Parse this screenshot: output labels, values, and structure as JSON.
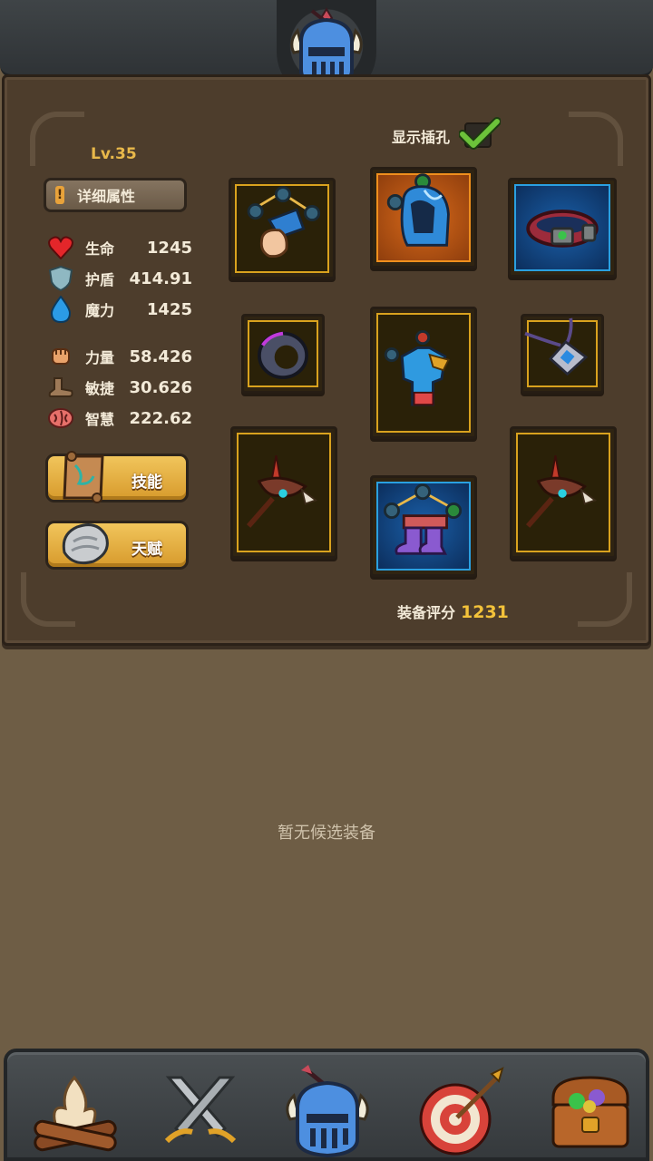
{
  "header": {
    "emblem_icon": "knight-helmet-icon"
  },
  "character": {
    "level": "Lv.35",
    "detail_button": "详细属性",
    "stats": [
      {
        "icon": "heart-icon",
        "label": "生命",
        "value": "1245"
      },
      {
        "icon": "shield-icon",
        "label": "护盾",
        "value": "414.91"
      },
      {
        "icon": "water-drop-icon",
        "label": "魔力",
        "value": "1425"
      }
    ],
    "attributes": [
      {
        "icon": "fist-icon",
        "label": "力量",
        "value": "58.426"
      },
      {
        "icon": "boot-icon",
        "label": "敏捷",
        "value": "30.626"
      },
      {
        "icon": "brain-icon",
        "label": "智慧",
        "value": "222.62"
      }
    ],
    "skill_button": "技能",
    "talent_button": "天赋"
  },
  "equipment": {
    "show_slots_label": "显示插孔",
    "show_slots_checked": true,
    "score_label": "装备评分",
    "score_value": "1231",
    "slots": [
      {
        "name": "gloves",
        "rarity": "gold"
      },
      {
        "name": "hood",
        "rarity": "orange"
      },
      {
        "name": "bracelet",
        "rarity": "blue"
      },
      {
        "name": "ring",
        "rarity": "gold"
      },
      {
        "name": "armor",
        "rarity": "gold"
      },
      {
        "name": "amulet",
        "rarity": "gold"
      },
      {
        "name": "weapon-left",
        "rarity": "gold"
      },
      {
        "name": "boots",
        "rarity": "blue"
      },
      {
        "name": "weapon-right",
        "rarity": "gold"
      }
    ]
  },
  "candidates": {
    "empty_message": "暂无候选装备"
  },
  "nav": [
    {
      "icon": "campfire-icon"
    },
    {
      "icon": "crossed-swords-icon"
    },
    {
      "icon": "knight-helmet-icon"
    },
    {
      "icon": "target-arrows-icon"
    },
    {
      "icon": "treasure-chest-icon"
    }
  ],
  "colors": {
    "gold_text": "#e8b84a",
    "panel": "#4d3d2c",
    "background": "#6e5d45"
  }
}
